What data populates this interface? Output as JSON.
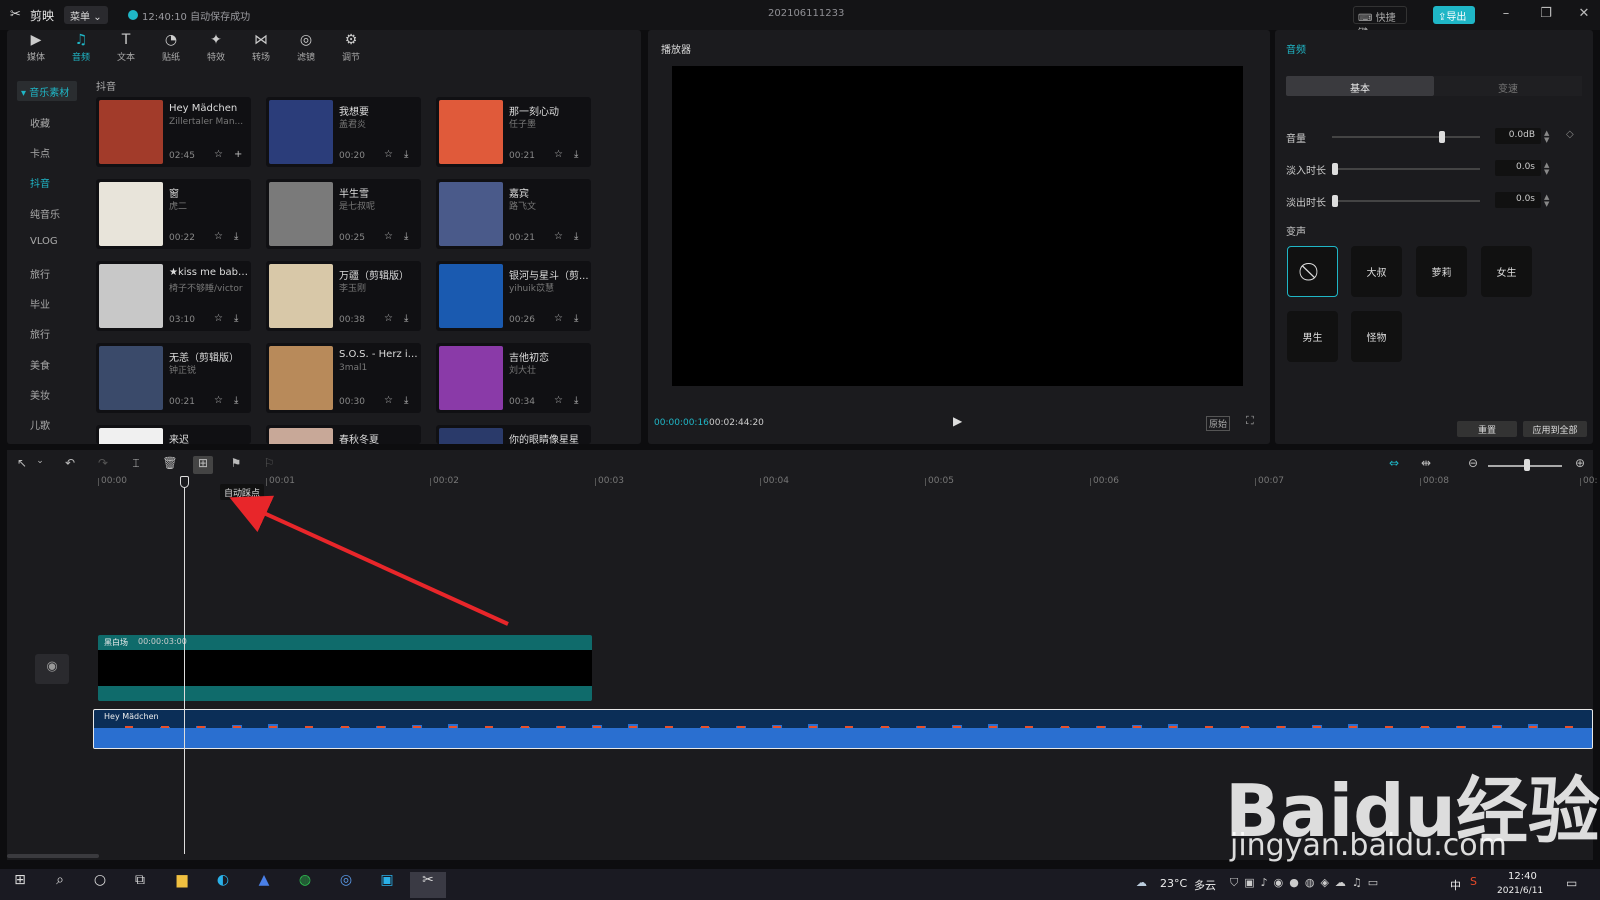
{
  "app": {
    "name": "剪映",
    "menu_label": "菜单",
    "autosave_text": "12:40:10 自动保存成功",
    "project_name": "202106111233",
    "shortcut_label": "快捷键",
    "export_label": "导出"
  },
  "toolbar": [
    {
      "label": "媒体",
      "icon": "media-icon"
    },
    {
      "label": "音频",
      "icon": "audio-icon"
    },
    {
      "label": "文本",
      "icon": "text-icon"
    },
    {
      "label": "贴纸",
      "icon": "sticker-icon"
    },
    {
      "label": "特效",
      "icon": "effects-icon"
    },
    {
      "label": "转场",
      "icon": "transition-icon"
    },
    {
      "label": "滤镜",
      "icon": "filter-icon"
    },
    {
      "label": "调节",
      "icon": "adjust-icon"
    }
  ],
  "categories": {
    "header": "音乐素材",
    "items": [
      "收藏",
      "卡点",
      "抖音",
      "纯音乐",
      "VLOG",
      "旅行",
      "毕业",
      "旅行",
      "美食",
      "美妆",
      "儿歌"
    ]
  },
  "section_title": "抖音",
  "cards": [
    {
      "title": "Hey Mädchen",
      "artist": "Zillertaler Man...",
      "duration": "02:45",
      "thumb": "#a23b2a"
    },
    {
      "title": "我想要",
      "artist": "盖君炎",
      "duration": "00:20",
      "thumb": "#2b3d7a"
    },
    {
      "title": "那一刻心动",
      "artist": "任子墨",
      "duration": "00:21",
      "thumb": "#e05a3a"
    },
    {
      "title": "窗",
      "artist": "虎二",
      "duration": "00:22",
      "thumb": "#e8e4da"
    },
    {
      "title": "半生雪",
      "artist": "是七叔呢",
      "duration": "00:25",
      "thumb": "#7a7a7a"
    },
    {
      "title": "嘉宾",
      "artist": "路飞文",
      "duration": "00:21",
      "thumb": "#4a5a8a"
    },
    {
      "title": "★kiss me baby...",
      "artist": "椅子不够睡/victor",
      "duration": "03:10",
      "thumb": "#c8c8c8"
    },
    {
      "title": "万疆（剪辑版）",
      "artist": "李玉刚",
      "duration": "00:38",
      "thumb": "#d8c8a8"
    },
    {
      "title": "银河与星斗（剪...",
      "artist": "yihuik苡慧",
      "duration": "00:26",
      "thumb": "#1a5ab0"
    },
    {
      "title": "无恙（剪辑版）",
      "artist": "钟正锐",
      "duration": "00:21",
      "thumb": "#3a4a6a"
    },
    {
      "title": "S.O.S. - Herz in...",
      "artist": "3mal1",
      "duration": "00:30",
      "thumb": "#b88a5a"
    },
    {
      "title": "吉他初恋",
      "artist": "刘大壮",
      "duration": "00:34",
      "thumb": "#8a3aa8"
    },
    {
      "title": "来迟",
      "artist": "",
      "duration": "",
      "thumb": "#f0f0f0"
    },
    {
      "title": "春秋冬夏",
      "artist": "",
      "duration": "",
      "thumb": "#c8a898"
    },
    {
      "title": "你的眼睛像星星",
      "artist": "",
      "duration": "",
      "thumb": "#2a3a6a"
    }
  ],
  "player": {
    "title": "播放器",
    "current_time": "00:00:00:16",
    "total_time": "00:02:44:20",
    "original_label": "原始"
  },
  "props": {
    "title": "音频",
    "tabs": [
      "基本",
      "变速"
    ],
    "volume": {
      "label": "音量",
      "value": "0.0dB",
      "level": 0.75
    },
    "fade_in": {
      "label": "淡入时长",
      "value": "0.0s",
      "level": 0
    },
    "fade_out": {
      "label": "淡出时长",
      "value": "0.0s",
      "level": 0
    },
    "voice_change_title": "变声",
    "voices": [
      "大叔",
      "萝莉",
      "女生",
      "男生",
      "怪物"
    ],
    "reset_label": "重置",
    "apply_all_label": "应用到全部"
  },
  "timeline": {
    "ticks": [
      "00:00",
      "00:01",
      "00:02",
      "00:03",
      "00:04",
      "00:05",
      "00:06",
      "00:07",
      "00:08",
      "00:"
    ],
    "tooltip": "自动踩点",
    "black_clip_label": "黑白场",
    "black_clip_duration": "00:00:03:00",
    "audio_clip_label": "Hey Mädchen"
  },
  "taskbar": {
    "temperature": "23°C",
    "weather": "多云",
    "time": "12:40",
    "date": "2021/6/11",
    "input_method": "中"
  },
  "watermark": {
    "main": "Baidu经验",
    "url": "jingyan.baidu.com"
  },
  "colors": {
    "accent": "#1fb6c6",
    "arrow": "#e8262a",
    "audio_wave": "#2a6fd0",
    "wave_peak": "#e8502a"
  }
}
